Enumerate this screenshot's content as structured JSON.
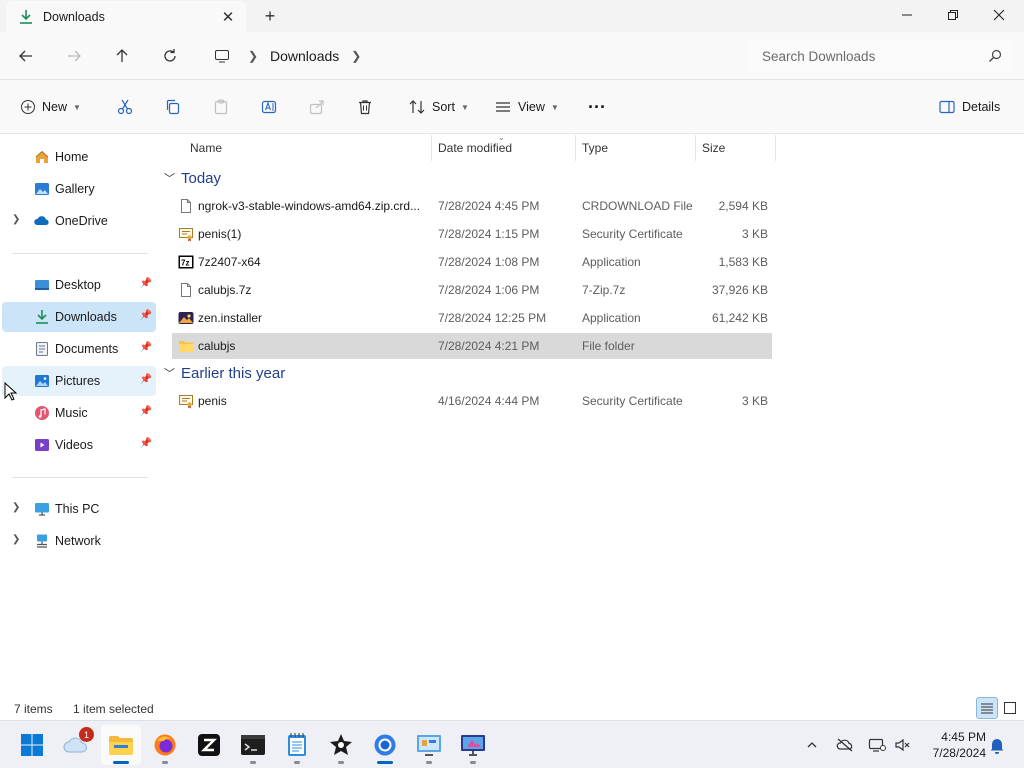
{
  "window": {
    "tab_title": "Downloads",
    "new_tab_symbol": "+",
    "close_symbol": "✕"
  },
  "address": {
    "breadcrumbs": [
      "Downloads"
    ],
    "search_placeholder": "Search Downloads"
  },
  "toolbar": {
    "new_label": "New",
    "sort_label": "Sort",
    "view_label": "View",
    "more_label": "···",
    "details_label": "Details"
  },
  "sidebar": {
    "items": [
      {
        "label": "Home",
        "icon": "home-icon"
      },
      {
        "label": "Gallery",
        "icon": "gallery-icon"
      },
      {
        "label": "OneDrive",
        "icon": "onedrive-icon"
      },
      {
        "label": "Desktop",
        "icon": "desktop-icon"
      },
      {
        "label": "Downloads",
        "icon": "downloads-icon"
      },
      {
        "label": "Documents",
        "icon": "documents-icon"
      },
      {
        "label": "Pictures",
        "icon": "pictures-icon"
      },
      {
        "label": "Music",
        "icon": "music-icon"
      },
      {
        "label": "Videos",
        "icon": "videos-icon"
      },
      {
        "label": "This PC",
        "icon": "this-pc-icon"
      },
      {
        "label": "Network",
        "icon": "network-icon"
      }
    ]
  },
  "columns": {
    "name": "Name",
    "date": "Date modified",
    "type": "Type",
    "size": "Size"
  },
  "groups": [
    {
      "label": "Today",
      "files": [
        {
          "name": "ngrok-v3-stable-windows-amd64.zip.crd...",
          "date": "7/28/2024 4:45 PM",
          "type": "CRDOWNLOAD File",
          "size": "2,594 KB",
          "icon": "blank-file-icon"
        },
        {
          "name": "penis(1)",
          "date": "7/28/2024 1:15 PM",
          "type": "Security Certificate",
          "size": "3 KB",
          "icon": "certificate-icon"
        },
        {
          "name": "7z2407-x64",
          "date": "7/28/2024 1:08 PM",
          "type": "Application",
          "size": "1,583 KB",
          "icon": "7zip-app-icon"
        },
        {
          "name": "calubjs.7z",
          "date": "7/28/2024 1:06 PM",
          "type": "7-Zip.7z",
          "size": "37,926 KB",
          "icon": "blank-file-icon"
        },
        {
          "name": "zen.installer",
          "date": "7/28/2024 12:25 PM",
          "type": "Application",
          "size": "61,242 KB",
          "icon": "zen-installer-icon"
        },
        {
          "name": "calubjs",
          "date": "7/28/2024 4:21 PM",
          "type": "File folder",
          "size": "",
          "icon": "folder-icon"
        }
      ]
    },
    {
      "label": "Earlier this year",
      "files": [
        {
          "name": "penis",
          "date": "4/16/2024 4:44 PM",
          "type": "Security Certificate",
          "size": "3 KB",
          "icon": "certificate-icon"
        }
      ]
    }
  ],
  "status": {
    "item_count": "7 items",
    "selection": "1 item selected"
  },
  "taskbar": {
    "weather_badge": "1",
    "time": "4:45 PM",
    "date": "7/28/2024"
  },
  "colors": {
    "accent": "#0067c0",
    "selected_nav": "#cce4f7",
    "selected_row": "#d9d9d9",
    "group_header": "#1f3f8f"
  }
}
